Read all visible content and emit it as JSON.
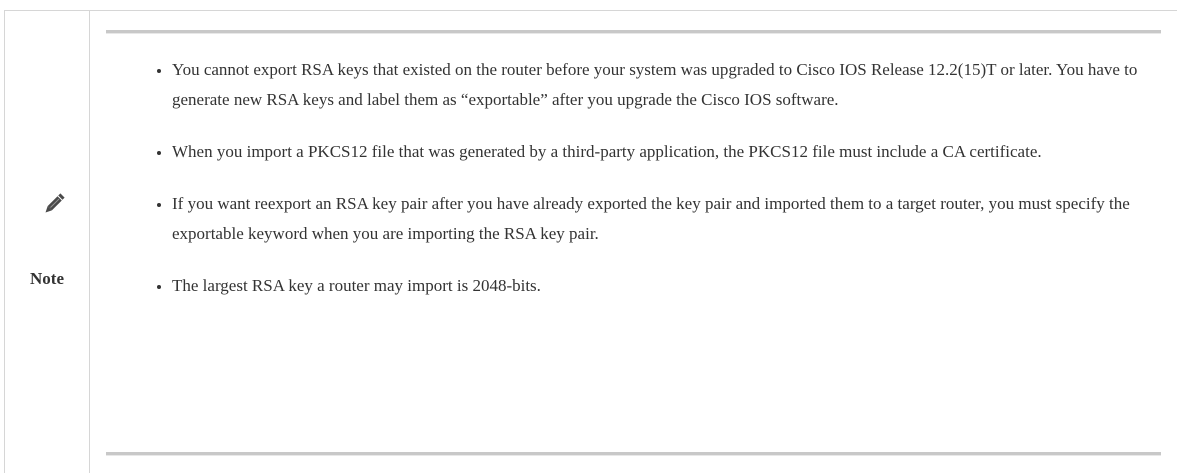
{
  "note": {
    "label": "Note",
    "icon": "pencil-icon",
    "items": [
      "You cannot export RSA keys that existed on the router before your system was upgraded to Cisco IOS Release 12.2(15)T or later. You have to generate new RSA keys and label them as “exportable” after you upgrade the Cisco IOS software.",
      "When you import a PKCS12 file that was generated by a third-party application, the PKCS12 file must include a CA certificate.",
      "If you want reexport an RSA key pair after you have already exported the key pair and imported them to a target router, you must specify the exportable keyword when you are importing the RSA key pair.",
      "The largest RSA key a router may import is 2048-bits."
    ]
  }
}
